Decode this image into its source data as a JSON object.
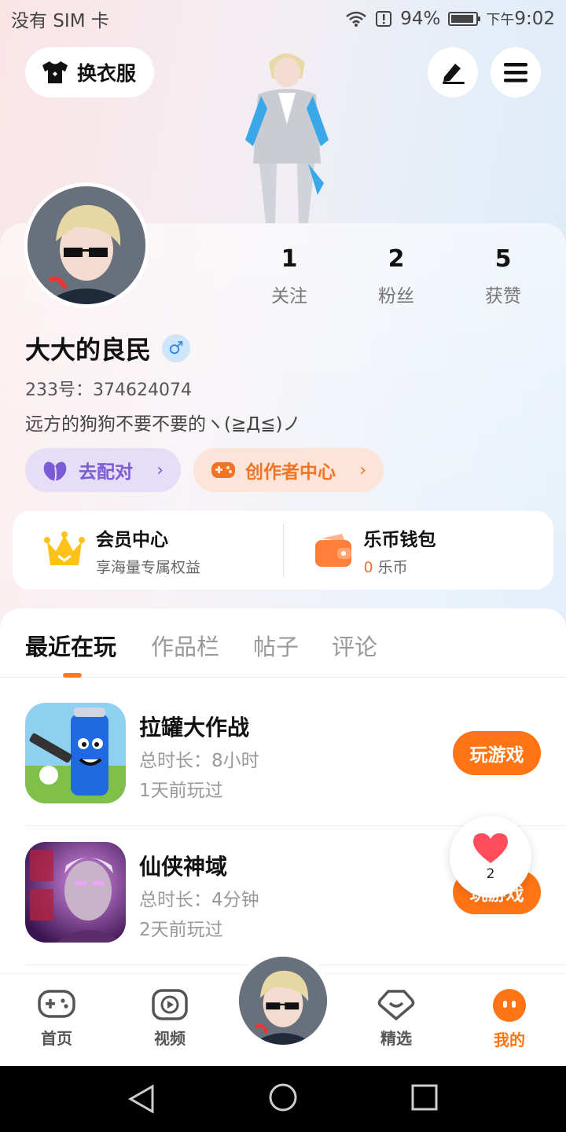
{
  "status_bar": {
    "carrier": "没有 SIM 卡",
    "battery": "94%",
    "time_prefix": "下午",
    "time": "9:02"
  },
  "top": {
    "outfit_label": "换衣服",
    "edit_icon": "pen-icon",
    "menu_icon": "menu-icon"
  },
  "profile": {
    "stats": [
      {
        "value": "1",
        "label": "关注"
      },
      {
        "value": "2",
        "label": "粉丝"
      },
      {
        "value": "5",
        "label": "获赞"
      }
    ],
    "username": "大大的良民",
    "gender_symbol": "♂",
    "uid": "233号：374624074",
    "bio": "远方的狗狗不要不要的ヽ(≧Д≦)ノ",
    "pair_label": "去配对",
    "creator_label": "创作者中心",
    "chevron": "›"
  },
  "member": {
    "vip_title": "会员中心",
    "vip_sub": "享海量专属权益",
    "wallet_title": "乐币钱包",
    "wallet_amount": "0",
    "wallet_unit": "乐币"
  },
  "tabs": [
    "最近在玩",
    "作品栏",
    "帖子",
    "评论"
  ],
  "games": [
    {
      "title": "拉罐大作战",
      "duration": "总时长：8小时",
      "last_played": "1天前玩过",
      "button": "玩游戏"
    },
    {
      "title": "仙侠神域",
      "duration": "总时长：4分钟",
      "last_played": "2天前玩过",
      "button": "玩游戏"
    }
  ],
  "like_float": {
    "count": "2"
  },
  "bottom_nav": [
    {
      "label": "首页",
      "icon": "gamepad-icon"
    },
    {
      "label": "视频",
      "icon": "video-play-icon"
    },
    {
      "label": "精选",
      "icon": "heart-chat-icon"
    },
    {
      "label": "我的",
      "icon": "profile-face-icon"
    }
  ],
  "colors": {
    "accent": "#ff7414",
    "pair": "#7b5bd6",
    "creator": "#f07426"
  }
}
